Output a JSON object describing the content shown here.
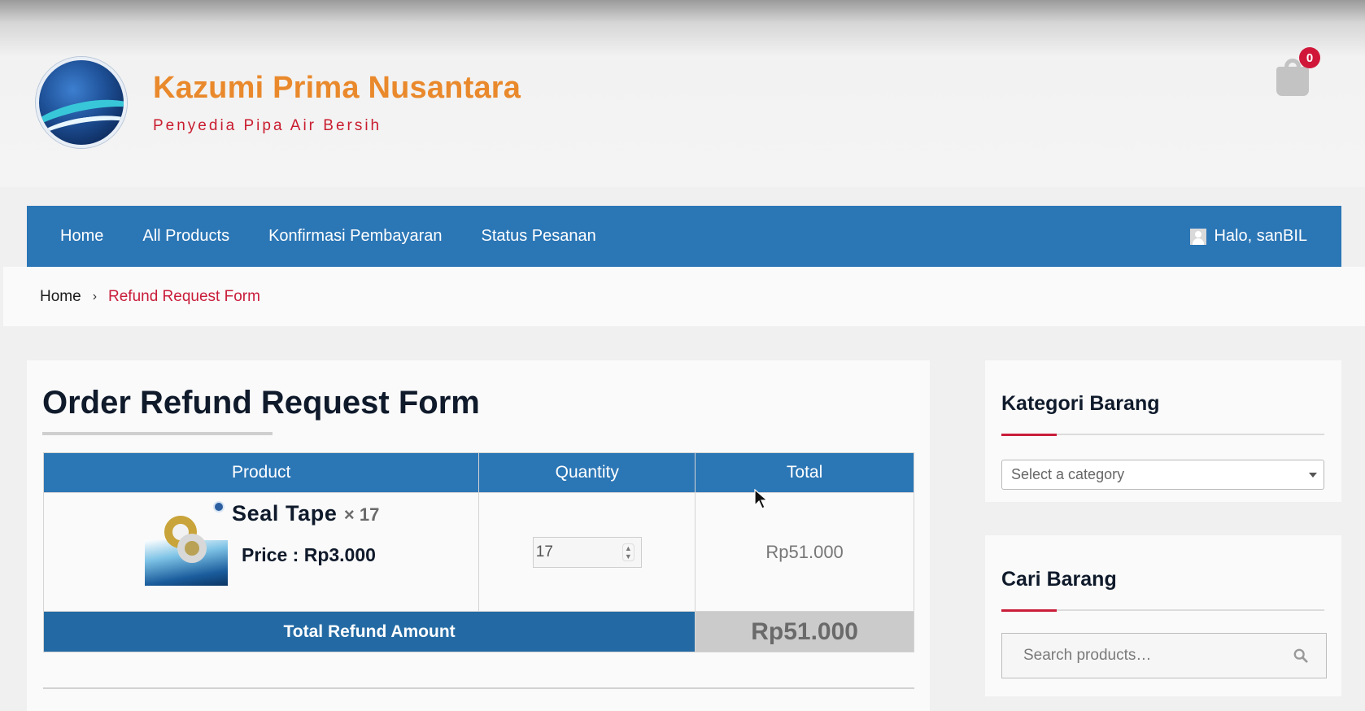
{
  "header": {
    "brand_name": "Kazumi Prima Nusantara",
    "tagline": "Penyedia Pipa Air Bersih",
    "cart_count": "0"
  },
  "nav": {
    "items": [
      {
        "label": "Home"
      },
      {
        "label": "All Products"
      },
      {
        "label": "Konfirmasi Pembayaran"
      },
      {
        "label": "Status Pesanan"
      }
    ],
    "user_greeting": "Halo, sanBIL"
  },
  "breadcrumb": {
    "home": "Home",
    "separator": "›",
    "current": "Refund Request Form"
  },
  "main": {
    "title": "Order Refund Request Form",
    "table": {
      "headers": [
        "Product",
        "Quantity",
        "Total"
      ],
      "row": {
        "product_name": "Seal Tape",
        "multiplier": "× 17",
        "price": "Price : Rp3.000",
        "quantity": "17",
        "total": "Rp51.000"
      },
      "footer_label": "Total Refund Amount",
      "footer_value": "Rp51.000"
    }
  },
  "sidebar": {
    "category": {
      "title": "Kategori Barang",
      "select_placeholder": "Select a category"
    },
    "search": {
      "title": "Cari Barang",
      "placeholder": "Search products…"
    }
  },
  "colors": {
    "primary": "#2b76b5",
    "brand_orange": "#e9892c",
    "accent_red": "#c91d3a"
  }
}
